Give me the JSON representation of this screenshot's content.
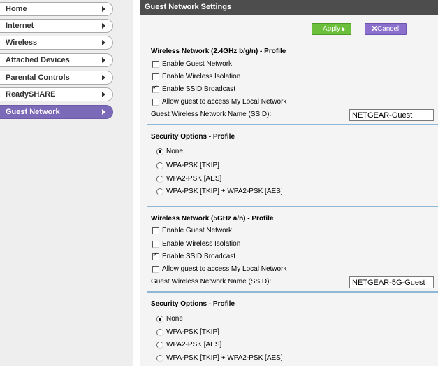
{
  "sidebar": {
    "items": [
      {
        "label": "Home",
        "active": false
      },
      {
        "label": "Internet",
        "active": false
      },
      {
        "label": "Wireless",
        "active": false
      },
      {
        "label": "Attached Devices",
        "active": false
      },
      {
        "label": "Parental Controls",
        "active": false
      },
      {
        "label": "ReadySHARE",
        "active": false
      },
      {
        "label": "Guest Network",
        "active": true
      }
    ]
  },
  "header": {
    "title": "Guest Network Settings"
  },
  "toolbar": {
    "apply_label": "Apply",
    "cancel_label": "Cancel"
  },
  "network_24": {
    "title": "Wireless Network (2.4GHz b/g/n) - Profile",
    "enable_guest": {
      "label": "Enable Guest Network",
      "checked": false
    },
    "wireless_isolation": {
      "label": "Enable Wireless Isolation",
      "checked": false
    },
    "ssid_broadcast": {
      "label": "Enable SSID Broadcast",
      "checked": true
    },
    "local_access": {
      "label": "Allow guest to access My Local Network",
      "checked": false
    },
    "ssid_label": "Guest Wireless Network Name (SSID):",
    "ssid_value": "NETGEAR-Guest"
  },
  "security_24": {
    "title": "Security Options - Profile",
    "options": [
      {
        "label": "None",
        "selected": true
      },
      {
        "label": "WPA-PSK [TKIP]",
        "selected": false
      },
      {
        "label": "WPA2-PSK [AES]",
        "selected": false
      },
      {
        "label": "WPA-PSK [TKIP] + WPA2-PSK [AES]",
        "selected": false
      }
    ]
  },
  "network_5": {
    "title": "Wireless Network (5GHz a/n) - Profile",
    "enable_guest": {
      "label": "Enable Guest Network",
      "checked": false
    },
    "wireless_isolation": {
      "label": "Enable Wireless Isolation",
      "checked": false
    },
    "ssid_broadcast": {
      "label": "Enable SSID Broadcast",
      "checked": true
    },
    "local_access": {
      "label": "Allow guest to access My Local Network",
      "checked": false
    },
    "ssid_label": "Guest Wireless Network Name (SSID):",
    "ssid_value": "NETGEAR-5G-Guest"
  },
  "security_5": {
    "title": "Security Options - Profile",
    "options": [
      {
        "label": "None",
        "selected": true
      },
      {
        "label": "WPA-PSK [TKIP]",
        "selected": false
      },
      {
        "label": "WPA2-PSK [AES]",
        "selected": false
      },
      {
        "label": "WPA-PSK [TKIP] + WPA2-PSK [AES]",
        "selected": false
      }
    ]
  },
  "colors": {
    "accent": "#7a6ab8",
    "apply": "#6cbf3a",
    "cancel": "#8a70cc",
    "separator": "#8eb8d6"
  }
}
